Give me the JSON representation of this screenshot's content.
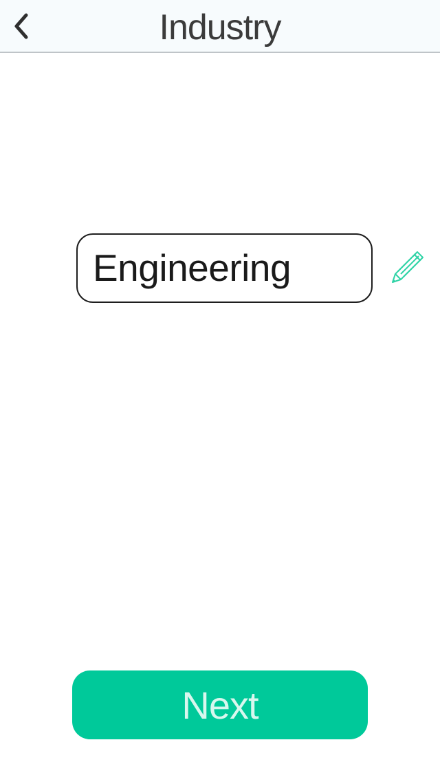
{
  "header": {
    "title": "Industry",
    "back_icon": "chevron-left-icon"
  },
  "form": {
    "industry_value": "Engineering",
    "edit_icon": "pencil-icon",
    "edit_icon_color": "#2fd3a6"
  },
  "footer": {
    "next_label": "Next",
    "next_color": "#00c99a"
  }
}
